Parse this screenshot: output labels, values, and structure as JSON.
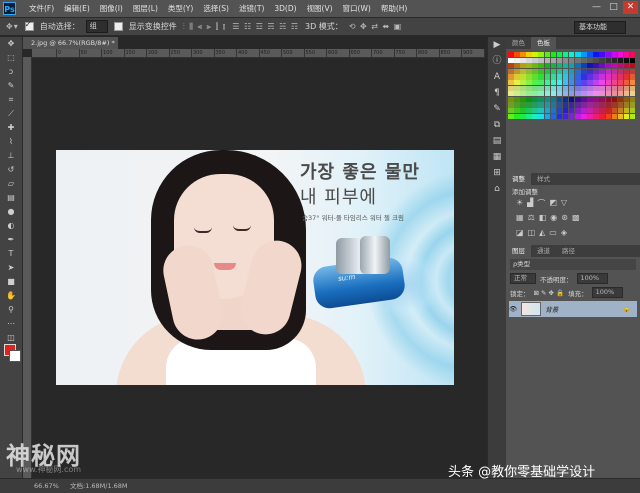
{
  "app": {
    "logo": "Ps"
  },
  "menu": [
    "文件(F)",
    "编辑(E)",
    "图像(I)",
    "图层(L)",
    "类型(Y)",
    "选择(S)",
    "滤镜(T)",
    "3D(D)",
    "视图(V)",
    "窗口(W)",
    "帮助(H)"
  ],
  "window_controls": {
    "minimize": "—",
    "maximize": "□",
    "close": "✕"
  },
  "options_bar": {
    "auto_select_label": "自动选择：",
    "auto_select_value": "组",
    "show_transform_label": "显示变换控件",
    "mode_3d_label": "3D 模式：",
    "workspace": "基本功能"
  },
  "document": {
    "tab_title": "2.jpg @ 66.7%(RGB/8#) *",
    "ruler_ticks": [
      "0",
      "50",
      "100",
      "150",
      "200",
      "250",
      "300",
      "350",
      "400",
      "450",
      "500",
      "550",
      "600",
      "650",
      "700",
      "750",
      "800",
      "850",
      "900",
      "950"
    ]
  },
  "artwork": {
    "headline_line1": "가장 좋은 물만",
    "headline_line2": "내 피부에",
    "subcopy": "숨37° 워터-풀 타임리스 워터 젤 크림",
    "jar_logo": "su:m"
  },
  "panels": {
    "color_tabs": [
      "颜色",
      "色板"
    ],
    "adjust_tabs": [
      "调整",
      "样式"
    ],
    "adjust_title": "添加调整",
    "layers_tabs": [
      "图层",
      "通道",
      "路径"
    ],
    "filter_label": "ρ类型",
    "blend_mode": "正常",
    "opacity_label": "不透明度：",
    "opacity_value": "100%",
    "lock_label": "锁定：",
    "fill_label": "填充：",
    "fill_value": "100%",
    "layer_name": "背景"
  },
  "status": {
    "zoom": "66.67%",
    "doc_size": "文档:1.68M/1.68M"
  },
  "watermarks": {
    "left": "神秘网",
    "left_sub": "www.神秘网.com",
    "right": "头条 @教你零基础学设计"
  },
  "colors": {
    "foreground": "#e2221f",
    "background": "#ffffff",
    "menubar": "#535353",
    "workspace": "#282828",
    "selected_layer": "#9fb2c7"
  },
  "icons": {
    "tools": [
      "move-icon",
      "marquee-icon",
      "lasso-icon",
      "quick-select-icon",
      "crop-icon",
      "eyedropper-icon",
      "healing-icon",
      "brush-icon",
      "stamp-icon",
      "history-brush-icon",
      "eraser-icon",
      "gradient-icon",
      "blur-icon",
      "dodge-icon",
      "pen-icon",
      "type-icon",
      "path-select-icon",
      "shape-icon",
      "hand-icon",
      "zoom-icon"
    ],
    "strip": [
      "play-icon",
      "info-icon",
      "character-icon",
      "paragraph-icon",
      "brush-preset-icon",
      "clone-source-icon",
      "notes-icon",
      "layer-comps-icon",
      "properties-icon",
      "tool-preset-icon"
    ]
  }
}
